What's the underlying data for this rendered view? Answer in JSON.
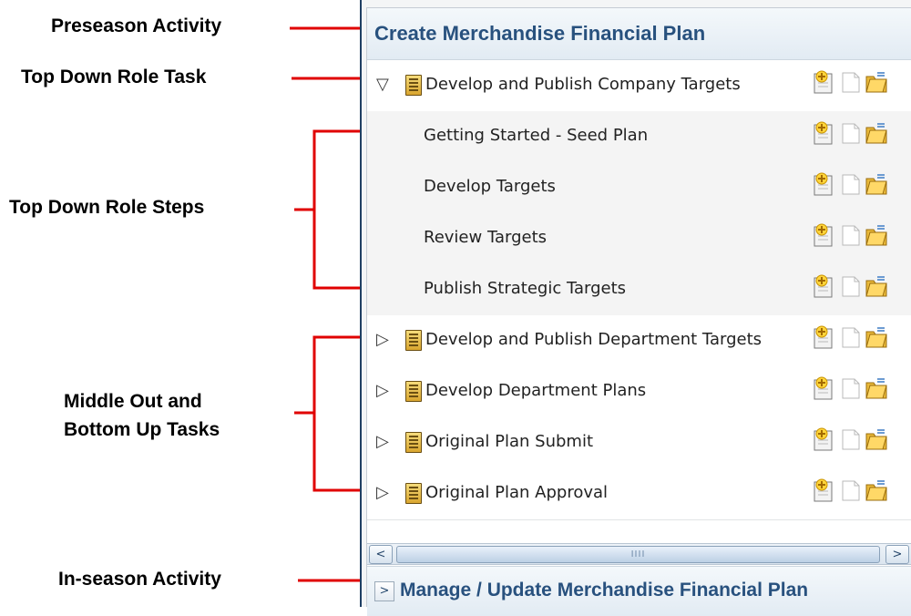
{
  "annotations": {
    "preseason": "Preseason Activity",
    "top_down_task": "Top Down Role Task",
    "top_down_steps": "Top Down Role Steps",
    "middle_out": "Middle Out and\nBottom Up Tasks",
    "in_season": "In-season Activity"
  },
  "panel": {
    "header_title": "Create Merchandise Financial Plan",
    "rows": [
      {
        "kind": "task",
        "expanded": true,
        "expander": "▽",
        "label": "Develop and Publish Company Targets"
      },
      {
        "kind": "step",
        "label": "Getting Started - Seed Plan"
      },
      {
        "kind": "step",
        "label": "Develop Targets"
      },
      {
        "kind": "step",
        "label": "Review Targets"
      },
      {
        "kind": "step",
        "label": "Publish Strategic Targets"
      },
      {
        "kind": "task",
        "expanded": false,
        "expander": "▷",
        "label": "Develop and Publish Department Targets"
      },
      {
        "kind": "task",
        "expanded": false,
        "expander": "▷",
        "label": "Develop Department Plans"
      },
      {
        "kind": "task",
        "expanded": false,
        "expander": "▷",
        "label": "Original Plan Submit"
      },
      {
        "kind": "task",
        "expanded": false,
        "expander": "▷",
        "label": "Original Plan Approval"
      }
    ],
    "row_actions": [
      "new-document-icon",
      "blank-page-icon",
      "open-folder-icon"
    ],
    "scrollbar": {
      "left_arrow": "<",
      "right_arrow": ">",
      "grip": "IIII"
    },
    "footer": {
      "expander": ">",
      "title": "Manage / Update Merchandise Financial Plan"
    }
  },
  "colors": {
    "callout_line": "#e00000",
    "header_text": "#28517e",
    "panel_border": "#1f3f63"
  }
}
